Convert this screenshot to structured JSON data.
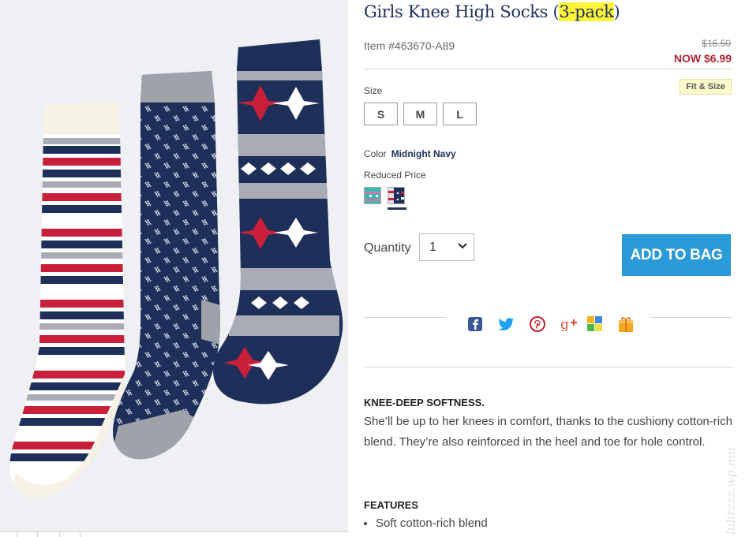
{
  "product": {
    "title_main": "Girls Knee High Socks (",
    "title_highlight": "3-pack",
    "title_end": ")",
    "item_number": "Item #463670-A89",
    "price_original": "$16.50",
    "price_now": "NOW $6.99"
  },
  "size": {
    "label": "Size",
    "fit_button": "Fit & Size",
    "options": [
      "S",
      "M",
      "L"
    ]
  },
  "color": {
    "label": "Color",
    "selected": "Midnight Navy",
    "reduced_label": "Reduced Price",
    "swatches": [
      {
        "name": "Teal Snowflake",
        "hex": "#3ab6b3"
      },
      {
        "name": "Midnight Navy",
        "hex": "#1e2f5a"
      }
    ]
  },
  "quantity": {
    "label": "Quantity",
    "value": "1"
  },
  "add_to_bag": "ADD TO BAG",
  "share": [
    "facebook-icon",
    "twitter-icon",
    "pinterest-icon",
    "google-plus-icon",
    "wanelo-icon",
    "gift-icon"
  ],
  "description": {
    "heading": "KNEE-DEEP SOFTNESS.",
    "body": "She’ll be up to her knees in comfort, thanks to the cushiony cotton-rich blend. They’re also reinforced in the heel and toe for hole control."
  },
  "features": {
    "heading": "FEATURES",
    "items": [
      "Soft cotton-rich blend"
    ]
  },
  "watermark": "lulirzzz.wp.mu",
  "colors": {
    "navy": "#1e2f5a",
    "red": "#b22234",
    "button_blue": "#2b9ad8",
    "highlight_yellow": "#fbf43b"
  }
}
